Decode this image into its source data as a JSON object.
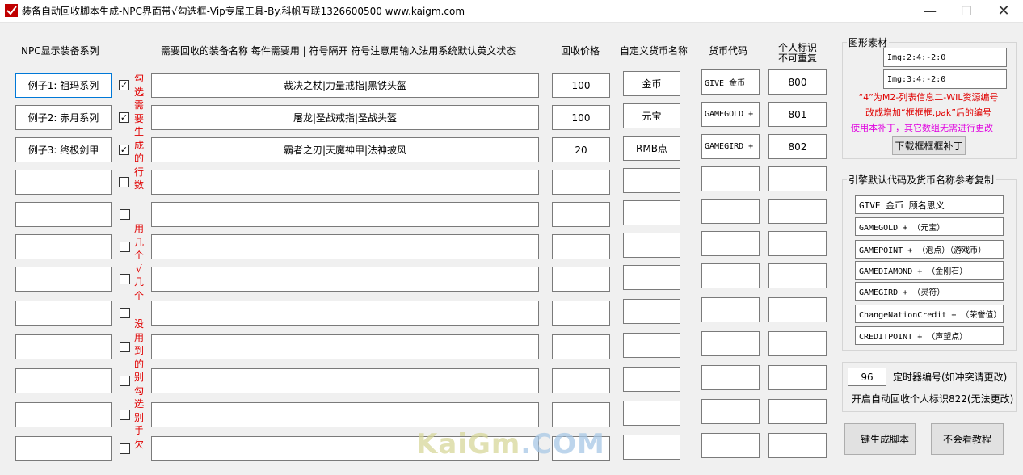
{
  "window": {
    "title": "装备自动回收脚本生成-NPC界面带√勾选框-Vip专属工具-By.科帆互联1326600500 www.kaigm.com",
    "min": "—",
    "max": "☐",
    "close": "✕"
  },
  "headers": {
    "npc_series": "NPC显示装备系列",
    "item_names": "需要回收的装备名称 每件需要用 | 符号隔开 符号注意用输入法用系统默认英文状态",
    "price": "回收价格",
    "currency_name": "自定义货币名称",
    "currency_code": "货币代码",
    "personal_id_1": "个人标识",
    "personal_id_2": "不可重复"
  },
  "rows": [
    {
      "series": "例子1: 祖玛系列",
      "checked": true,
      "items": "裁决之杖|力量戒指|黑铁头盔",
      "price": "100",
      "currency": "金币",
      "code": "GIVE 金币",
      "id": "800"
    },
    {
      "series": "例子2: 赤月系列",
      "checked": true,
      "items": "屠龙|圣战戒指|圣战头盔",
      "price": "100",
      "currency": "元宝",
      "code": "GAMEGOLD +",
      "id": "801"
    },
    {
      "series": "例子3: 终极剑甲",
      "checked": true,
      "items": "霸者之刃|天魔神甲|法神披风",
      "price": "20",
      "currency": "RMB点",
      "code": "GAMEGIRD +",
      "id": "802"
    },
    {
      "series": "",
      "checked": false,
      "items": "",
      "price": "",
      "currency": "",
      "code": "",
      "id": ""
    },
    {
      "series": "",
      "checked": false,
      "items": "",
      "price": "",
      "currency": "",
      "code": "",
      "id": ""
    },
    {
      "series": "",
      "checked": false,
      "items": "",
      "price": "",
      "currency": "",
      "code": "",
      "id": ""
    },
    {
      "series": "",
      "checked": false,
      "items": "",
      "price": "",
      "currency": "",
      "code": "",
      "id": ""
    },
    {
      "series": "",
      "checked": false,
      "items": "",
      "price": "",
      "currency": "",
      "code": "",
      "id": ""
    },
    {
      "series": "",
      "checked": false,
      "items": "",
      "price": "",
      "currency": "",
      "code": "",
      "id": ""
    },
    {
      "series": "",
      "checked": false,
      "items": "",
      "price": "",
      "currency": "",
      "code": "",
      "id": ""
    },
    {
      "series": "",
      "checked": false,
      "items": "",
      "price": "",
      "currency": "",
      "code": "",
      "id": ""
    },
    {
      "series": "",
      "checked": false,
      "items": "",
      "price": "",
      "currency": "",
      "code": "",
      "id": ""
    }
  ],
  "vertical_notes": {
    "a": "勾选需要生成的行数",
    "b": "用几个√几个",
    "c": "没用到的别勾选别手欠"
  },
  "graphics_group": {
    "label": "图形素材",
    "field1": "Img:2:4:-2:0",
    "field2": "Img:3:4:-2:0",
    "note1": "“4”为M2-列表信息二-WIL资源编号",
    "note2": "改成增加“框框框.pak”后的编号",
    "note3": "使用本补丁，其它数组无需进行更改",
    "download_button": "下载框框框补丁"
  },
  "engine_group": {
    "label": "引擎默认代码及货币名称参考复制",
    "items": [
      "GIVE 金币 顾名思义",
      "GAMEGOLD + （元宝）",
      "GAMEPOINT + （泡点）（游戏币）",
      "GAMEDIAMOND + （金刚石）",
      "GAMEGIRD + （灵符）",
      "ChangeNationCredit + （荣誉值）",
      "CREDITPOINT + （声望点）"
    ]
  },
  "timer": {
    "value": "96",
    "label": "定时器编号(如冲突请更改)",
    "note": "开启自动回收个人标识822(无法更改)"
  },
  "buttons": {
    "generate": "一键生成脚本",
    "tutorial": "不会看教程"
  },
  "watermark": {
    "part1": "KaiGm",
    "part2": ".COM"
  }
}
